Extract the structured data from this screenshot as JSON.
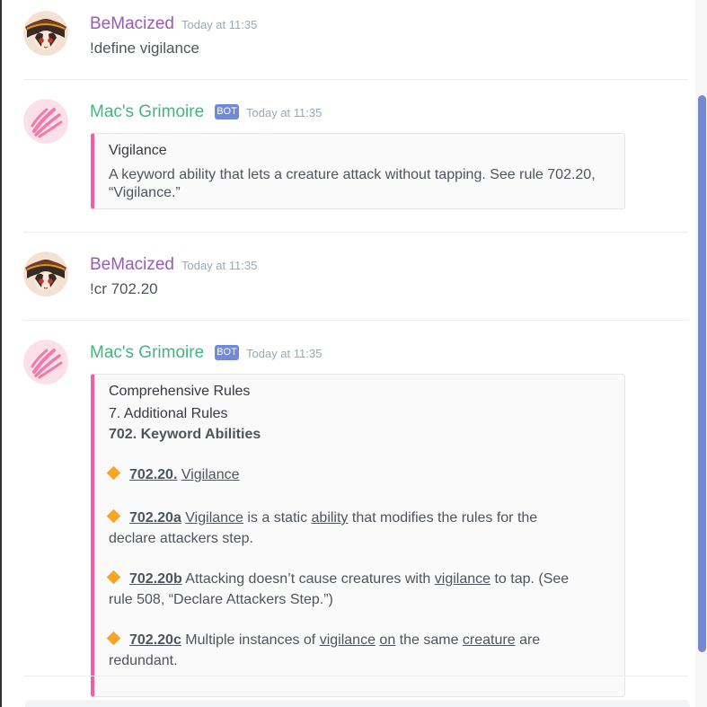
{
  "colors": {
    "user_name": "#9b59b6",
    "bot_name": "#43b581",
    "embed_border": "#f15ea8",
    "diamond": "#f6a623",
    "bot_tag": "#7289da"
  },
  "messages": [
    {
      "author": "BeMacized",
      "timestamp": "Today at 11:35",
      "text": "!define vigilance"
    },
    {
      "author": "Mac's Grimoire",
      "bot_tag": "BOT",
      "timestamp": "Today at 11:35",
      "embed": {
        "title": "Vigilance",
        "desc_line1": "A keyword ability that lets a creature attack without tapping. See rule 702.20,",
        "desc_line2": "“Vigilance.”"
      }
    },
    {
      "author": "BeMacized",
      "timestamp": "Today at 11:35",
      "text": "!cr 702.20"
    },
    {
      "author": "Mac's Grimoire",
      "bot_tag": "BOT",
      "timestamp": "Today at 11:35",
      "embed": {
        "line1": "Comprehensive Rules",
        "line2": "7. Additional Rules",
        "line3": "702. Keyword Abilities",
        "rules": [
          {
            "id": "702.20.",
            "parts": [
              "Vigilance"
            ]
          },
          {
            "id": "702.20a",
            "word1": "Vigilance",
            "mid1": " is a static ",
            "word2": "ability",
            "mid2": " that modifies the rules for the",
            "line2": "declare attackers step."
          },
          {
            "id": "702.20b",
            "pre": " Attacking doesn’t cause creatures with ",
            "word1": "vigilance",
            "post": " to tap. (See",
            "line2": "rule 508, “Declare Attackers Step.”)"
          },
          {
            "id": "702.20c",
            "pre": " Multiple instances of ",
            "word1": "vigilance",
            "sp1": " ",
            "word2": "on",
            "mid": " the same ",
            "word3": "creature",
            "post": " are",
            "line2": "redundant."
          }
        ]
      }
    }
  ]
}
